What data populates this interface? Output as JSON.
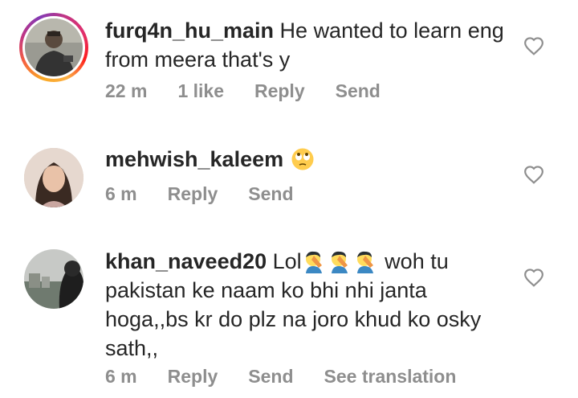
{
  "comments": [
    {
      "username": "furq4n_hu_main",
      "text": "He  wanted to learn eng from meera that's y",
      "time": "22 m",
      "likes": "1 like",
      "reply": "Reply",
      "send": "Send",
      "has_story_ring": true
    },
    {
      "username": "mehwish_kaleem",
      "emoji": "face-with-rolling-eyes",
      "time": "6 m",
      "reply": "Reply",
      "send": "Send"
    },
    {
      "username": "khan_naveed20",
      "text_before": "Lol",
      "emojis": [
        "man-facepalming",
        "man-facepalming",
        "man-facepalming"
      ],
      "text_after": " woh tu pakistan ke naam ko bhi nhi janta hoga,,bs kr do plz na joro khud ko osky sath,,",
      "time": "6 m",
      "reply": "Reply",
      "send": "Send",
      "translation": "See translation"
    }
  ],
  "colors": {
    "text": "#262626",
    "meta": "#8e8e8e",
    "heart": "#8e8e8e"
  }
}
